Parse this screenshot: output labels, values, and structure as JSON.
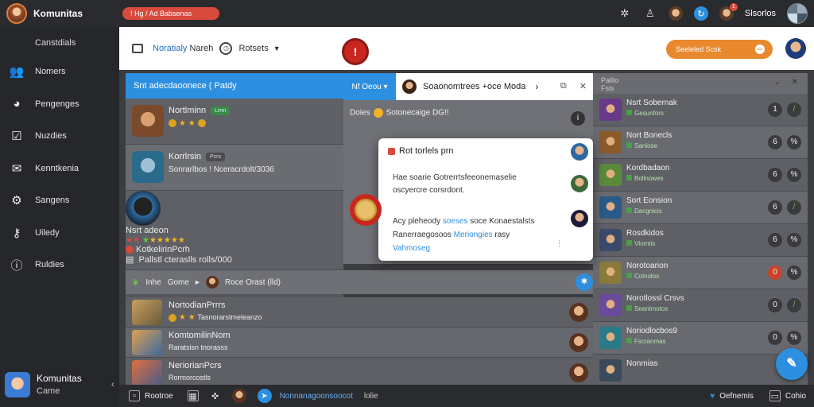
{
  "titlebar": {
    "app_title": "Komunitas",
    "alert_text": "! Hg  /  Ad Babsenas",
    "username": "Slsorlos",
    "notification_count": "1"
  },
  "sidebar": {
    "header": "Canstdials",
    "items": [
      {
        "label": "Nomers",
        "icon": "people-icon",
        "glyph": "👥"
      },
      {
        "label": "Pengenges",
        "icon": "compass-icon",
        "glyph": "◕"
      },
      {
        "label": "Nuzdies",
        "icon": "inbox-icon",
        "glyph": "☑"
      },
      {
        "label": "Kenntkenia",
        "icon": "mail-icon",
        "glyph": "✉"
      },
      {
        "label": "Sangens",
        "icon": "settings-icon",
        "glyph": "⚙"
      },
      {
        "label": "Uiledy",
        "icon": "key-icon",
        "glyph": "⚷"
      },
      {
        "label": "Ruldies",
        "icon": "help-icon",
        "glyph": "ⓘ"
      }
    ],
    "profile": {
      "name": "Komunitas",
      "sub": "Came"
    }
  },
  "topbar": {
    "crumb_accent": "Noratialy",
    "crumb_rest": " Nareh",
    "settings_label": "Rotsets",
    "cta_label": "Seeleled Scsk"
  },
  "left_panel": {
    "header": "Snt adecdaoonece  ( Patdy",
    "rows": [
      {
        "name": "Nortlminn",
        "tag": "Lrnn",
        "sub": "",
        "avatar_color": "#7a4a2a"
      },
      {
        "name": "Korrlrsin",
        "tag": "Pcrs",
        "sub": "Sonrarlbos ! Nceracrdolt/3036",
        "avatar_color": "#2a6a8a"
      }
    ],
    "big_row": {
      "name": "Nsrt adeon",
      "sub_name": "Kotkelirin",
      "tag": "Pcrh",
      "sub": "Pallstl  cteraslls rolls/000"
    }
  },
  "section_bar": {
    "label_a": "Inhe",
    "label_b": "Gome",
    "label_c": "Roce Orast (lld)"
  },
  "feed_rows": [
    {
      "name": "Nortodian",
      "tag": "Prrrs",
      "sub": "Tasnorarstmeleanzo",
      "color": "#6a5a3a"
    },
    {
      "name": "Komtomilin",
      "tag": "Nom",
      "sub": "Raratsisn  tnorasss",
      "color": "#8a6a3a"
    },
    {
      "name": "Neriorian",
      "tag": "Pcrs",
      "sub": "Rormorcostls",
      "color": "#4a5a8a"
    }
  ],
  "mid_panel": {
    "tab_label": "Nf Oeou",
    "title": "Soaonomtrees +oce Moda",
    "line_a": "Doies",
    "line_b": "Sotonecaige DG!!",
    "popup": {
      "head": "Rot torlels prn",
      "p1": "Hae soarie Gotrerrtsfeeonemaselie oscyercre corsrdont.",
      "p2_a": "Acy pleheody ",
      "p2_link1": "soeses",
      "p2_b": " soce Konaestalsts Ranerraegosoos ",
      "p2_link2": "Meriongies",
      "p2_c": " rasy",
      "p2_link3": "Vahmoseg"
    }
  },
  "right_panel": {
    "header_a": "Palllo",
    "header_b": "Fsis",
    "rows": [
      {
        "name": "Nsrt Sobernak",
        "status": "Gesunfors",
        "b1": "1",
        "b2": "/",
        "red": false,
        "green": true,
        "color": "#6a3a8a"
      },
      {
        "name": "Nort Bonecls",
        "status": "Sanlose",
        "b1": "6",
        "b2": "%",
        "red": false,
        "green": false,
        "color": "#8a5a2a"
      },
      {
        "name": "Kordbadaon",
        "status": "Bollnowes",
        "b1": "6",
        "b2": "%",
        "red": false,
        "green": false,
        "color": "#5a8a3a"
      },
      {
        "name": "Sort Eonsion",
        "status": "Dacgnicis",
        "b1": "6",
        "b2": "/",
        "red": false,
        "green": true,
        "color": "#2a5a8a"
      },
      {
        "name": "Rosdkidos",
        "status": "Vlomtis",
        "b1": "6",
        "b2": "%",
        "red": false,
        "green": false,
        "color": "#3a4a6a"
      },
      {
        "name": "Norotoarion",
        "status": "Colnolos",
        "b1": "0",
        "b2": "%",
        "red": true,
        "green": false,
        "color": "#8a7a3a"
      },
      {
        "name": "Norotlossl Crsvs",
        "status": "Seanlmotos",
        "b1": "0",
        "b2": "/",
        "red": false,
        "green": true,
        "color": "#6a4a9a"
      },
      {
        "name": "Noriodlocbos9",
        "status": "Fscranmas",
        "b1": "0",
        "b2": "%",
        "red": false,
        "green": false,
        "color": "#2a7a8a"
      },
      {
        "name": "Nonmias",
        "status": "",
        "b1": "",
        "b2": "",
        "red": false,
        "green": false,
        "color": "#3a4a5a"
      }
    ]
  },
  "bottombar": {
    "a": "Rootroe",
    "b": "Nonnanagoonsoocot",
    "c": "lolie",
    "right_a": "Oefnemis",
    "right_b": "Cohio"
  }
}
